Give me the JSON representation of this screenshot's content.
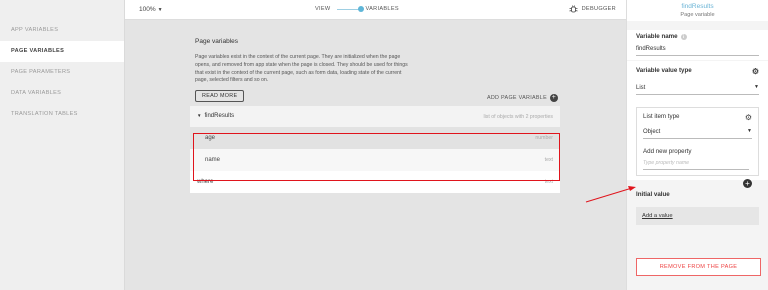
{
  "sidebar": {
    "items": [
      {
        "label": "APP VARIABLES"
      },
      {
        "label": "PAGE VARIABLES"
      },
      {
        "label": "PAGE PARAMETERS"
      },
      {
        "label": "DATA VARIABLES"
      },
      {
        "label": "TRANSLATION TABLES"
      }
    ]
  },
  "topbar": {
    "zoom": "100%",
    "view_label": "VIEW",
    "variables_label": "VARIABLES",
    "debugger_label": "DEBUGGER"
  },
  "main": {
    "title": "Page variables",
    "description": "Page variables exist in the context of the current page. They are initialized when the page opens, and removed from app state when the page is closed. They should be used for things that exist in the context of the current page, such as form data, loading state of the current page, selected filters and so on.",
    "read_more": "READ MORE",
    "add_page_variable": "ADD PAGE VARIABLE",
    "variables": [
      {
        "name": "findResults",
        "meta": "list of objects with 2 properties",
        "properties": [
          {
            "name": "age",
            "type": "number"
          },
          {
            "name": "name",
            "type": "text"
          }
        ]
      },
      {
        "name": "where",
        "type": "text"
      }
    ]
  },
  "panel": {
    "header_title": "findResults",
    "header_subtitle": "Page variable",
    "variable_name_label": "Variable name",
    "variable_name_value": "findResults",
    "value_type_label": "Variable value type",
    "value_type_value": "List",
    "list_item_type_label": "List item type",
    "list_item_type_value": "Object",
    "add_property_label": "Add new property",
    "property_placeholder": "Type property name",
    "initial_value_label": "Initial value",
    "add_value_label": "Add a value",
    "remove_label": "REMOVE FROM THE PAGE"
  },
  "colors": {
    "accent": "#5fb6d8",
    "highlight": "#e0141c",
    "danger": "#e44444"
  }
}
